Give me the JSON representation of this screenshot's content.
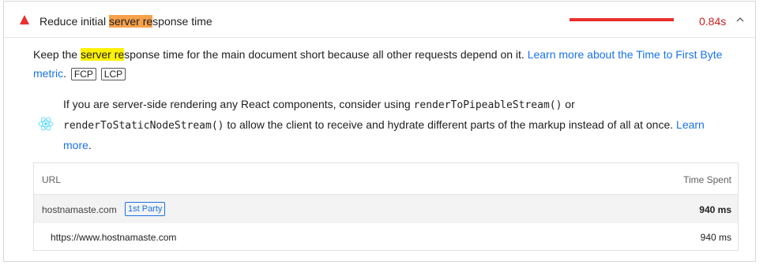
{
  "audit": {
    "title_parts": [
      "Reduce initial ",
      "server re",
      "sponse time"
    ],
    "value": "0.84s",
    "status_color": "#eb2e2e",
    "icons": {
      "status": "warning-triangle-icon",
      "toggle": "chevron-up-icon",
      "stack": "react-icon"
    }
  },
  "description": {
    "parts": [
      "Keep the ",
      "server re",
      "sponse time for the main document short because all other requests depend on it. "
    ],
    "link": "Learn more about the Time to First Byte metric",
    "after_link": ".",
    "tags": [
      "FCP",
      "LCP"
    ]
  },
  "react_note": {
    "text1": "If you are server-side rendering any React components, consider using ",
    "code1": "renderToPipeableStream()",
    "text2": " or ",
    "code2": "renderToStaticNodeStream()",
    "text3": " to allow the client to receive and hydrate different parts of the markup instead of all at once. ",
    "link": "Learn more",
    "after_link": "."
  },
  "table": {
    "headers": {
      "url": "URL",
      "time": "Time Spent"
    },
    "group": {
      "domain": "hostnamaste.com",
      "badge": "1st Party",
      "time": "940 ms"
    },
    "rows": [
      {
        "url": "https://www.hostnamaste.com",
        "time": "940 ms"
      }
    ]
  }
}
